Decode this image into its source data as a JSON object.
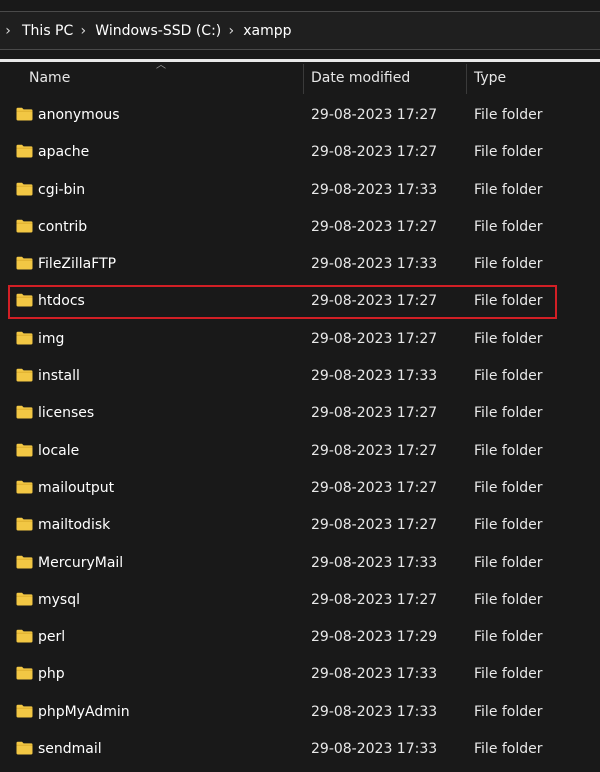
{
  "breadcrumb": {
    "items": [
      {
        "label": "This PC"
      },
      {
        "label": "Windows-SSD (C:)"
      },
      {
        "label": "xampp"
      }
    ]
  },
  "columns": {
    "name": "Name",
    "date": "Date modified",
    "type": "Type"
  },
  "files": [
    {
      "name": "anonymous",
      "date": "29-08-2023 17:27",
      "type": "File folder"
    },
    {
      "name": "apache",
      "date": "29-08-2023 17:27",
      "type": "File folder"
    },
    {
      "name": "cgi-bin",
      "date": "29-08-2023 17:33",
      "type": "File folder"
    },
    {
      "name": "contrib",
      "date": "29-08-2023 17:27",
      "type": "File folder"
    },
    {
      "name": "FileZillaFTP",
      "date": "29-08-2023 17:33",
      "type": "File folder"
    },
    {
      "name": "htdocs",
      "date": "29-08-2023 17:27",
      "type": "File folder",
      "highlighted": true
    },
    {
      "name": "img",
      "date": "29-08-2023 17:27",
      "type": "File folder"
    },
    {
      "name": "install",
      "date": "29-08-2023 17:33",
      "type": "File folder"
    },
    {
      "name": "licenses",
      "date": "29-08-2023 17:27",
      "type": "File folder"
    },
    {
      "name": "locale",
      "date": "29-08-2023 17:27",
      "type": "File folder"
    },
    {
      "name": "mailoutput",
      "date": "29-08-2023 17:27",
      "type": "File folder"
    },
    {
      "name": "mailtodisk",
      "date": "29-08-2023 17:27",
      "type": "File folder"
    },
    {
      "name": "MercuryMail",
      "date": "29-08-2023 17:33",
      "type": "File folder"
    },
    {
      "name": "mysql",
      "date": "29-08-2023 17:27",
      "type": "File folder"
    },
    {
      "name": "perl",
      "date": "29-08-2023 17:29",
      "type": "File folder"
    },
    {
      "name": "php",
      "date": "29-08-2023 17:33",
      "type": "File folder"
    },
    {
      "name": "phpMyAdmin",
      "date": "29-08-2023 17:33",
      "type": "File folder"
    },
    {
      "name": "sendmail",
      "date": "29-08-2023 17:33",
      "type": "File folder"
    }
  ],
  "colors": {
    "background": "#191919",
    "folder": "#f2c744",
    "highlight_border": "#d21f25"
  },
  "icons": {
    "folder": "folder-icon",
    "breadcrumb_separator": "chevron-right-icon",
    "sort": "chevron-up-icon"
  }
}
